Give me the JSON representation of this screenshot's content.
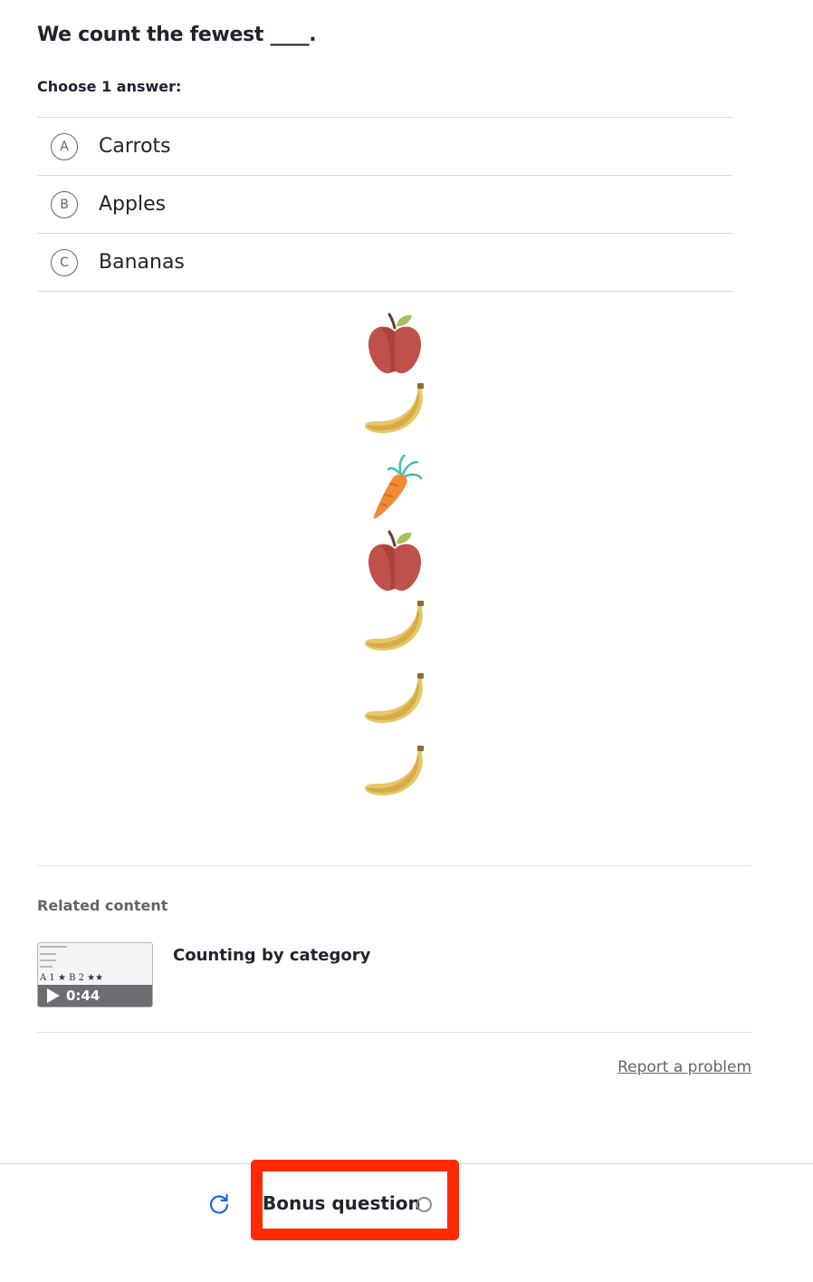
{
  "question": {
    "text": "We count the fewest ____.",
    "instruction": "Choose 1 answer:"
  },
  "choices": [
    {
      "letter": "A",
      "label": "Carrots"
    },
    {
      "letter": "B",
      "label": "Apples"
    },
    {
      "letter": "C",
      "label": "Bananas"
    }
  ],
  "fruits": [
    "apple-icon",
    "banana-icon",
    "carrot-icon",
    "apple-icon",
    "banana-icon",
    "banana-icon",
    "banana-icon"
  ],
  "related": {
    "heading": "Related content",
    "video_title": "Counting by category",
    "video_duration": "0:44",
    "thumb_text": "A 1 ★ B 2 ★★"
  },
  "report_link": "Report a problem",
  "footer": {
    "bonus_label": "Bonus question"
  },
  "colors": {
    "highlight": "#ff2a00",
    "restart_icon": "#1865f2"
  }
}
